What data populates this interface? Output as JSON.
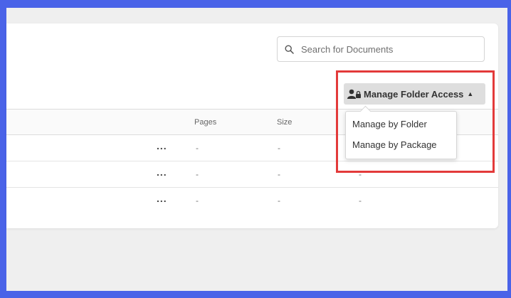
{
  "search": {
    "placeholder": "Search for Documents"
  },
  "manage_button": {
    "label": "Manage Folder Access"
  },
  "table": {
    "columns": {
      "pages": "Pages",
      "size": "Size"
    },
    "rows": [
      {
        "actions": "...",
        "pages": "-",
        "size": "-",
        "extra": ""
      },
      {
        "actions": "...",
        "pages": "-",
        "size": "-",
        "extra": "-"
      },
      {
        "actions": "...",
        "pages": "-",
        "size": "-",
        "extra": "-"
      }
    ]
  },
  "dropdown": {
    "items": [
      "Manage by Folder",
      "Manage by Package"
    ]
  },
  "colors": {
    "frame": "#4a63e8",
    "highlight": "#e33a3a",
    "button_bg": "#dedede"
  }
}
